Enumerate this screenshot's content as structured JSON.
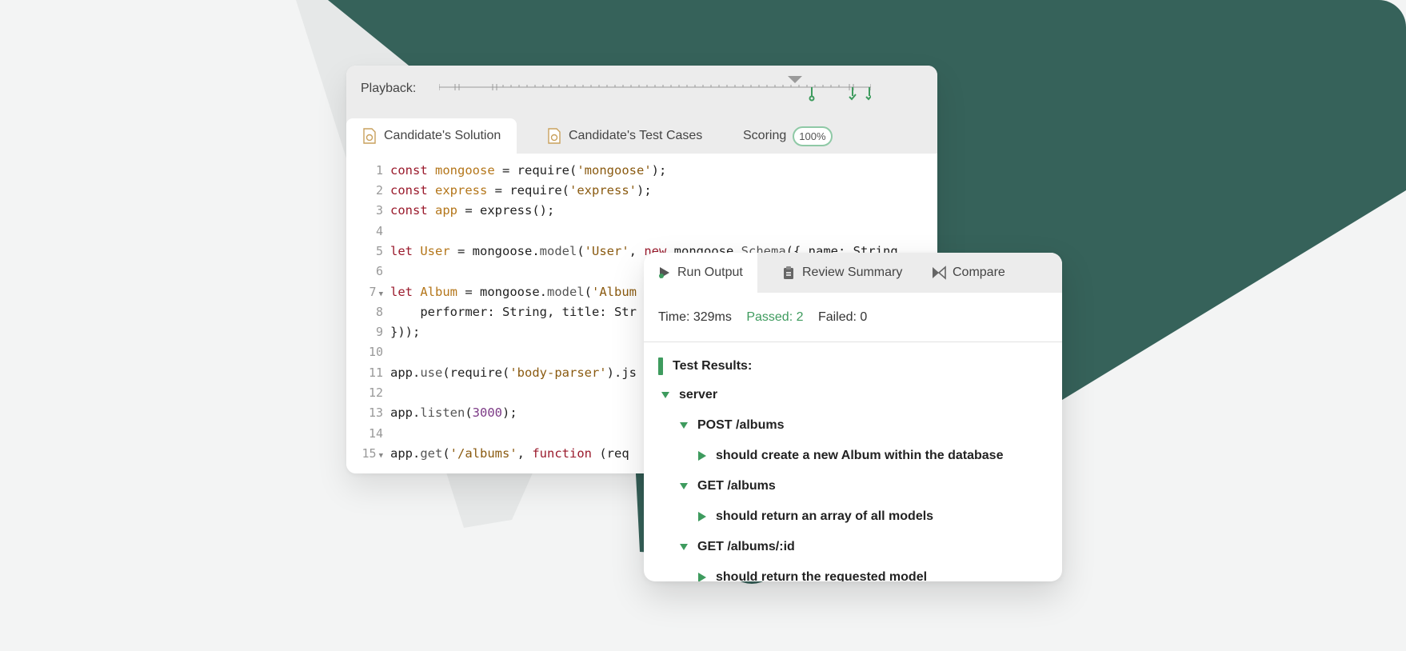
{
  "colors": {
    "accent_green": "#3e9b5e",
    "dark_teal": "#36625a",
    "background": "#f3f4f4"
  },
  "playback": {
    "label": "Playback:"
  },
  "editor_tabs": [
    {
      "label": "Candidate's Solution",
      "icon": "file-code-icon",
      "active": true
    },
    {
      "label": "Candidate's Test Cases",
      "icon": "file-code-icon",
      "active": false
    },
    {
      "label": "Scoring",
      "badge": "100%",
      "active": false
    }
  ],
  "code_lines": [
    {
      "n": "1"
    },
    {
      "n": "2"
    },
    {
      "n": "3"
    },
    {
      "n": "4"
    },
    {
      "n": "5"
    },
    {
      "n": "6"
    },
    {
      "n": "7"
    },
    {
      "n": "8"
    },
    {
      "n": "9"
    },
    {
      "n": "10"
    },
    {
      "n": "11"
    },
    {
      "n": "12"
    },
    {
      "n": "13"
    },
    {
      "n": "14"
    },
    {
      "n": "15"
    }
  ],
  "code": {
    "l1": [
      "const",
      " ",
      "mongoose",
      " = require(",
      "'mongoose'",
      ");"
    ],
    "l2": [
      "const",
      " ",
      "express",
      " = require(",
      "'express'",
      ");"
    ],
    "l3": [
      "const",
      " ",
      "app",
      " = express();"
    ],
    "l5": [
      "let",
      " ",
      "User",
      " = mongoose.",
      "model",
      "(",
      "'User'",
      ", ",
      "new",
      " mongoose.",
      "Schema",
      "({ name: String"
    ],
    "l7": [
      "let",
      " ",
      "Album",
      " = mongoose.",
      "model",
      "(",
      "'Album"
    ],
    "l8": [
      "    performer: String, title: Str"
    ],
    "l9": [
      "}));"
    ],
    "l11": [
      "app.",
      "use",
      "(require(",
      "'body-parser'",
      ").js"
    ],
    "l13": [
      "app.",
      "listen",
      "(",
      "3000",
      ");"
    ],
    "l15": [
      "app.",
      "get",
      "(",
      "'/albums'",
      ", ",
      "function",
      " (req"
    ]
  },
  "output_tabs": [
    {
      "label": "Run Output",
      "icon": "play-icon",
      "active": true
    },
    {
      "label": "Review Summary",
      "icon": "clipboard-icon",
      "active": false
    },
    {
      "label": "Compare",
      "icon": "compare-icon",
      "active": false
    }
  ],
  "stats": {
    "time": "Time: 329ms",
    "passed": "Passed: 2",
    "failed": "Failed: 0"
  },
  "results": {
    "title": "Test Results:",
    "tree": [
      {
        "label": "server",
        "level": 0,
        "expanded": true
      },
      {
        "label": "POST /albums",
        "level": 1,
        "expanded": true
      },
      {
        "label": "should create a new Album within the database",
        "level": 2,
        "expanded": false
      },
      {
        "label": "GET /albums",
        "level": 1,
        "expanded": true
      },
      {
        "label": "should return an array of all models",
        "level": 2,
        "expanded": false
      },
      {
        "label": "GET /albums/:id",
        "level": 1,
        "expanded": true
      },
      {
        "label": "should return the requested model",
        "level": 2,
        "expanded": false
      }
    ]
  }
}
